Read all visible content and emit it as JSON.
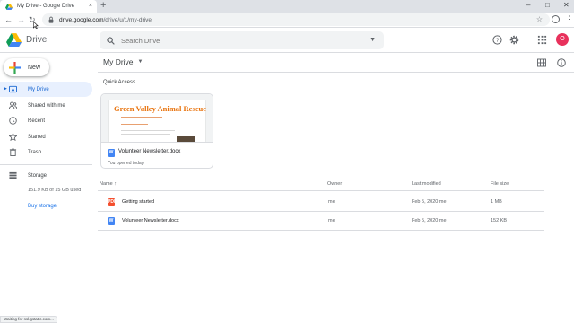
{
  "browser": {
    "tab_title": "My Drive - Google Drive",
    "tab_close": "×",
    "new_tab": "+",
    "url_host": "drive.google.com",
    "url_path": "/drive/u/1/my-drive",
    "window_min": "–",
    "window_max": "□",
    "window_close": "✕",
    "status_text": "Waiting for ssl.gstatic.com..."
  },
  "header": {
    "product": "Drive",
    "search_placeholder": "Search Drive",
    "avatar_letter": "O",
    "icons": [
      "help-icon",
      "settings-icon",
      "apps-icon"
    ]
  },
  "sidebar": {
    "new_label": "New",
    "items": [
      {
        "label": "My Drive",
        "icon": "drive-icon",
        "active": true
      },
      {
        "label": "Shared with me",
        "icon": "people-icon"
      },
      {
        "label": "Recent",
        "icon": "clock-icon"
      },
      {
        "label": "Starred",
        "icon": "star-icon"
      },
      {
        "label": "Trash",
        "icon": "trash-icon"
      }
    ],
    "storage_label": "Storage",
    "storage_text": "151.9 KB of 15 GB used",
    "buy_storage": "Buy storage"
  },
  "main": {
    "title": "My Drive",
    "quick_access_label": "Quick Access",
    "quick_access": [
      {
        "name": "Volunteer Newsletter.docx",
        "subtitle": "You opened today",
        "preview_heading": "Green Valley Animal Rescue",
        "file_type_letter": "W"
      }
    ],
    "columns": {
      "name": "Name",
      "sort_arrow": "↑",
      "owner": "Owner",
      "modified": "Last modified",
      "size": "File size"
    },
    "files": [
      {
        "name": "Getting started",
        "owner": "me",
        "modified": "Feb 5, 2020 me",
        "size": "1 MB",
        "type": "pdf"
      },
      {
        "name": "Volunteer Newsletter.docx",
        "owner": "me",
        "modified": "Feb 5, 2020 me",
        "size": "152 KB",
        "type": "word"
      }
    ]
  },
  "colors": {
    "accent_blue": "#1a73e8",
    "active_bg": "#e8f0fe",
    "avatar_bg": "#e8315c",
    "preview_heading": "#e8710a"
  }
}
